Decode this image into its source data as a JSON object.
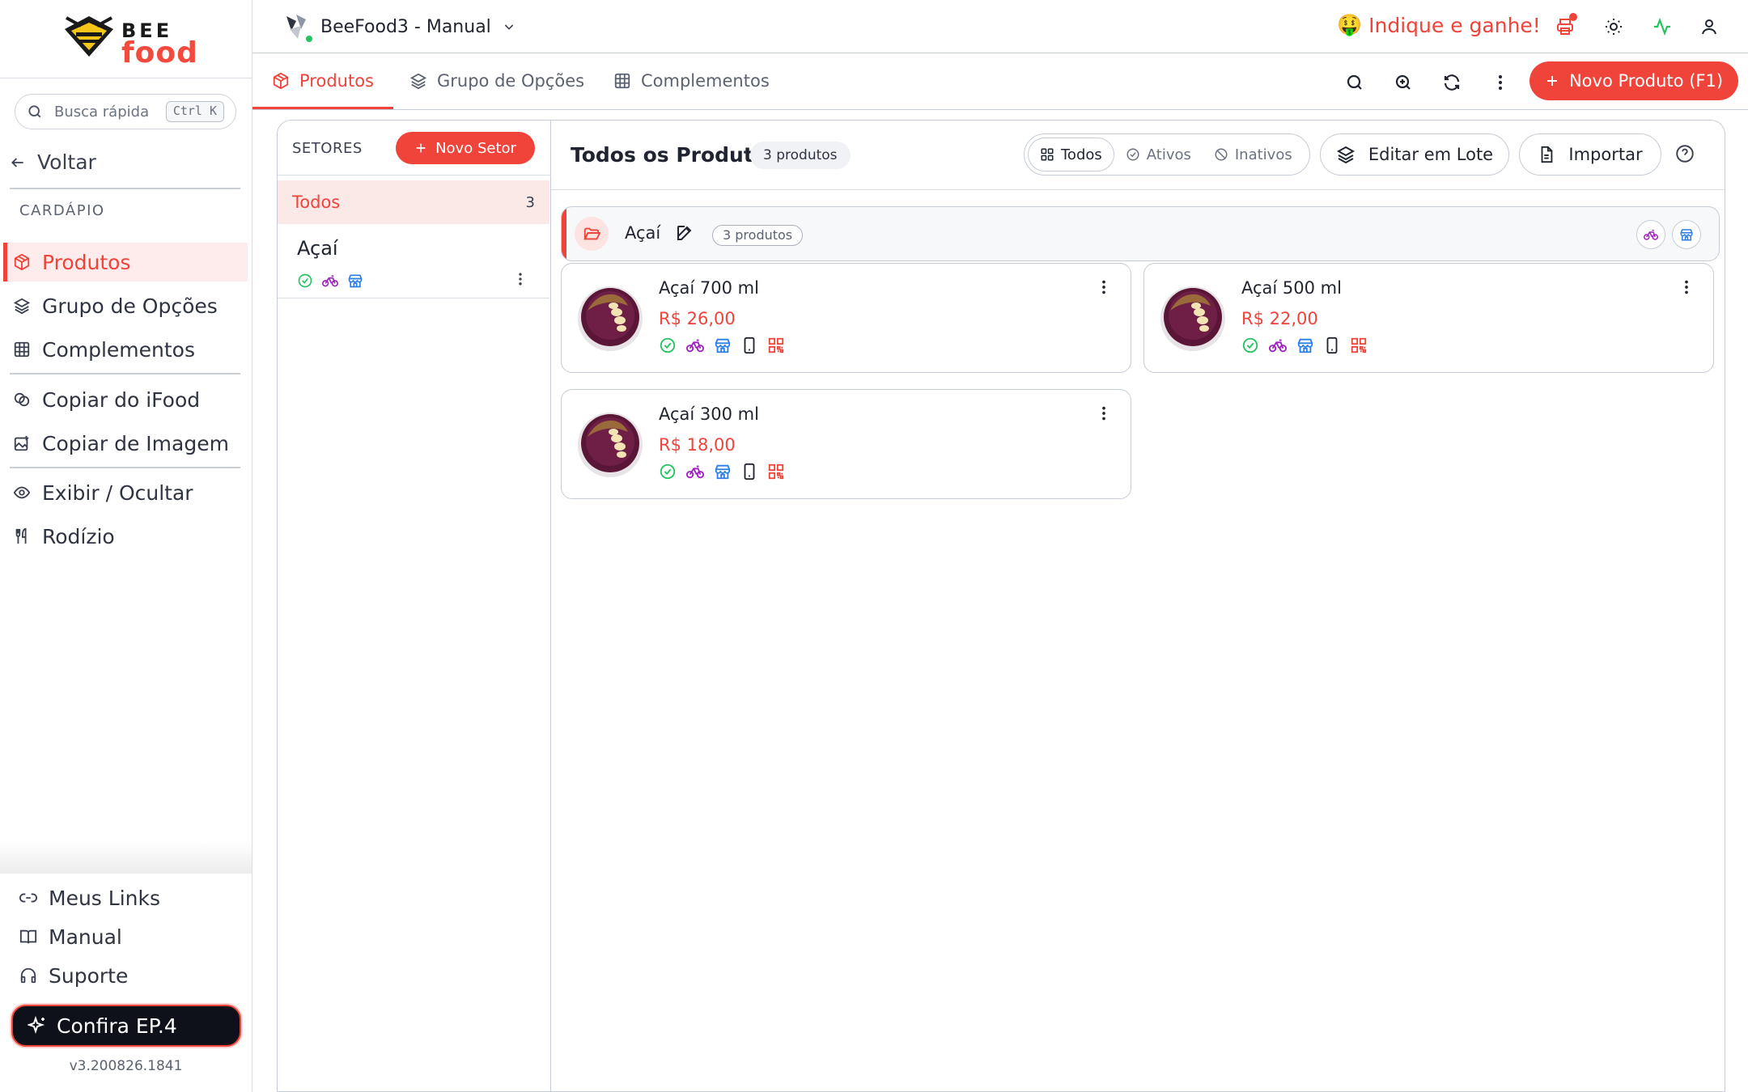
{
  "sidebar": {
    "logo_top": "BEE",
    "logo_bottom": "food",
    "search_placeholder": "Busca rápida",
    "search_shortcut": "Ctrl K",
    "back_label": "Voltar",
    "section_label": "CARDÁPIO",
    "items": [
      {
        "label": "Produtos",
        "icon": "box-icon",
        "active": true
      },
      {
        "label": "Grupo de Opções",
        "icon": "layers-icon"
      },
      {
        "label": "Complementos",
        "icon": "grid-icon"
      },
      {
        "label": "Copiar do iFood",
        "icon": "clone-icon"
      },
      {
        "label": "Copiar de Imagem",
        "icon": "image-plus-icon"
      },
      {
        "label": "Exibir / Ocultar",
        "icon": "eye-icon"
      },
      {
        "label": "Rodízio",
        "icon": "utensils-icon"
      }
    ],
    "bottom_items": [
      {
        "label": "Meus Links",
        "icon": "link-icon"
      },
      {
        "label": "Manual",
        "icon": "book-icon"
      },
      {
        "label": "Suporte",
        "icon": "headset-icon"
      }
    ],
    "promo_label": "Confira EP.4",
    "version": "v3.200826.1841"
  },
  "topbar": {
    "store_name": "BeeFood3 - Manual",
    "referral_emoji": "🤑",
    "referral_label": "Indique e ganhe!",
    "icons": [
      "printer-icon",
      "sun-icon",
      "activity-icon",
      "user-icon"
    ]
  },
  "tabs": [
    {
      "label": "Produtos",
      "icon": "box-icon",
      "active": true
    },
    {
      "label": "Grupo de Opções",
      "icon": "layers-icon"
    },
    {
      "label": "Complementos",
      "icon": "grid-icon"
    }
  ],
  "toolbar": {
    "new_product_label": "Novo Produto (F1)"
  },
  "sectors": {
    "header": "SETORES",
    "new_sector_label": "Novo Setor",
    "all_label": "Todos",
    "all_count": "3",
    "list": [
      {
        "name": "Açaí"
      }
    ]
  },
  "content": {
    "title": "Todos os Produtos",
    "count_badge": "3 produtos",
    "filters": [
      {
        "label": "Todos",
        "active": true
      },
      {
        "label": "Ativos"
      },
      {
        "label": "Inativos"
      }
    ],
    "batch_edit_label": "Editar em Lote",
    "import_label": "Importar",
    "group": {
      "name": "Açaí",
      "count": "3 produtos"
    },
    "products": [
      {
        "name": "Açaí 700 ml",
        "price": "R$ 26,00"
      },
      {
        "name": "Açaí 500 ml",
        "price": "R$ 22,00"
      },
      {
        "name": "Açaí 300 ml",
        "price": "R$ 18,00"
      }
    ]
  },
  "colors": {
    "accent": "#f0433a",
    "active_bg": "#fdeceb",
    "status_green": "#22c55e",
    "delivery_purple": "#a020c0",
    "store_blue": "#2b7de9"
  }
}
